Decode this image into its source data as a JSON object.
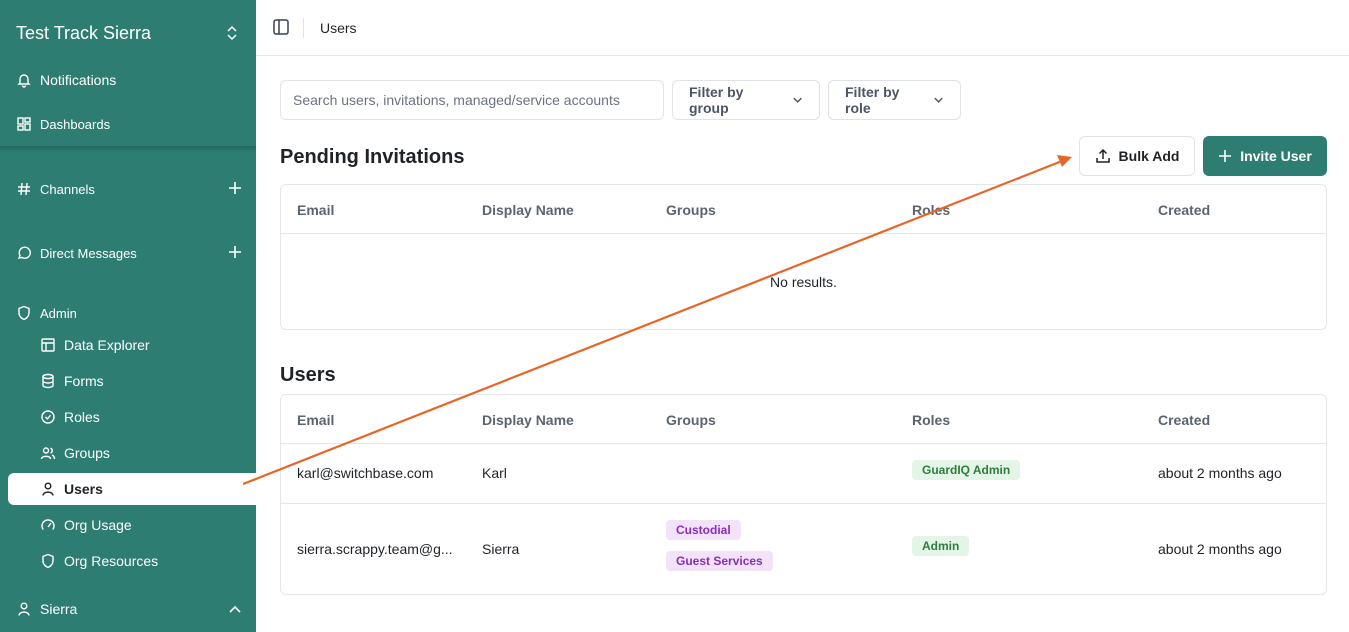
{
  "sidebar": {
    "org_name": "Test Track Sierra",
    "notifications": "Notifications",
    "dashboards": "Dashboards",
    "channels": "Channels",
    "direct_messages": "Direct Messages",
    "admin": "Admin",
    "admin_items": [
      "Data Explorer",
      "Forms",
      "Roles",
      "Groups",
      "Users",
      "Org Usage",
      "Org Resources"
    ],
    "user_name": "Sierra",
    "active_item": "Users"
  },
  "header": {
    "title": "Users"
  },
  "controls": {
    "search_placeholder": "Search users, invitations, managed/service accounts",
    "filter_group": "Filter by group",
    "filter_role": "Filter by role"
  },
  "pending": {
    "title": "Pending Invitations",
    "bulk_add": "Bulk Add",
    "invite_user": "Invite User",
    "columns": [
      "Email",
      "Display Name",
      "Groups",
      "Roles",
      "Created"
    ],
    "empty_text": "No results."
  },
  "users": {
    "title": "Users",
    "columns": [
      "Email",
      "Display Name",
      "Groups",
      "Roles",
      "Created"
    ],
    "rows": [
      {
        "email": "karl@switchbase.com",
        "display_name": "Karl",
        "groups": [],
        "roles": [
          "GuardIQ Admin"
        ],
        "created": "about 2 months ago"
      },
      {
        "email": "sierra.scrappy.team@g...",
        "display_name": "Sierra",
        "groups": [
          "Custodial",
          "Guest Services"
        ],
        "roles": [
          "Admin"
        ],
        "created": "about 2 months ago"
      }
    ]
  },
  "colors": {
    "brand": "#2e7d72",
    "annotation_arrow": "#e8652a",
    "badge_purple": "#8a2eb8",
    "badge_green": "#2f7d3c"
  }
}
